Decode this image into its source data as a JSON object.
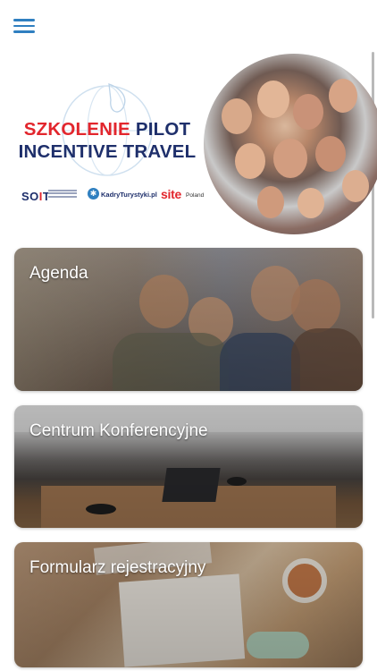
{
  "header": {
    "menu_icon": "hamburger-menu-icon"
  },
  "banner": {
    "title_word_red": "SZKOLENIE",
    "title_word_navy": "PILOT",
    "title_line2": "INCENTIVE TRAVEL",
    "sponsors": {
      "soit_prefix": "SO",
      "soit_i": "I",
      "soit_suffix": "T",
      "kadry": "KadryTurystyki.pl",
      "site": "site",
      "site_country": "Poland"
    },
    "colors": {
      "red": "#e2262d",
      "navy": "#1e2f6b",
      "accent": "#2f7fc0"
    }
  },
  "cards": [
    {
      "title": "Agenda"
    },
    {
      "title": "Centrum Konferencyjne"
    },
    {
      "title": "Formularz rejestracyjny"
    }
  ]
}
